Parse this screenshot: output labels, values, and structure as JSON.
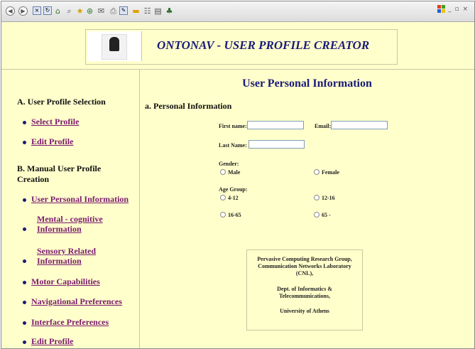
{
  "app": {
    "title": "ONTONAV - USER PROFILE CREATOR"
  },
  "window_controls": "_ ▫ ×",
  "sidebar": {
    "section_a": "A. User Profile Selection",
    "section_b": "B. Manual User Profile Creation",
    "items_a": [
      {
        "label": "Select Profile"
      },
      {
        "label": "Edit Profile"
      }
    ],
    "items_b": [
      {
        "label": "User Personal Information"
      },
      {
        "label": "Mental - cognitive Information"
      },
      {
        "label": "Sensory Related Information"
      },
      {
        "label": "Motor Capabilities"
      },
      {
        "label": "Navigational Preferences"
      },
      {
        "label": "Interface Preferences"
      },
      {
        "label": "Edit Profile"
      }
    ]
  },
  "main": {
    "title": "User Personal Information",
    "subtitle": "a. Personal Information",
    "form": {
      "first_name_label": "First name:",
      "first_name_value": "",
      "email_label": "Email:",
      "email_value": "",
      "last_name_label": "Last Name:",
      "last_name_value": "",
      "gender_label": "Gender:",
      "gender_options": [
        "Male",
        "Female"
      ],
      "age_label": "Age Group:",
      "age_options": [
        "4-12",
        "12-16",
        "16-65",
        "65 -"
      ]
    },
    "credits": {
      "line1": "Pervasive Computing Research Group,",
      "line2": "Communication Networks Laboratory",
      "line3": "(CNL),",
      "line4": "Dept. of Informatics &",
      "line5": "Telecommunications,",
      "line6": "University of Athens"
    }
  },
  "colors": {
    "page_bg": "#ffffcc",
    "title": "#1a1a7a",
    "link": "#7a1a6e"
  }
}
